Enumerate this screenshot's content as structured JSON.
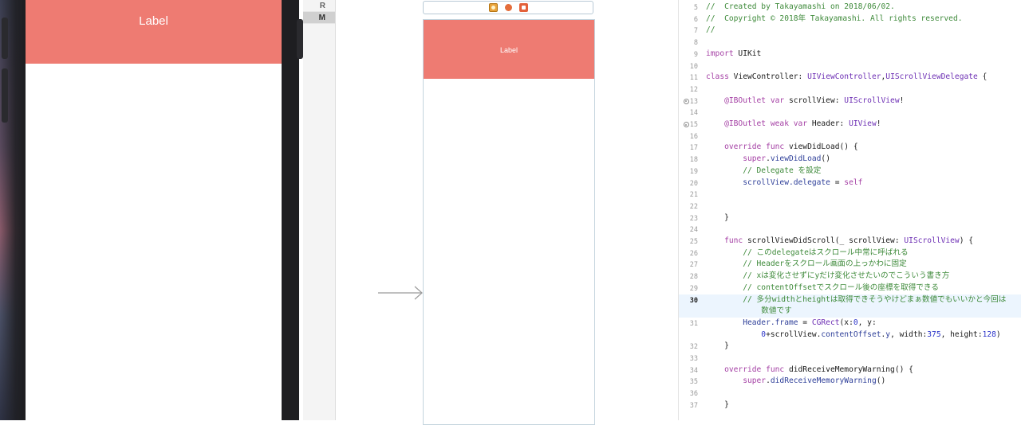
{
  "simulator": {
    "header_label": "Label"
  },
  "outline_strip": {
    "rows": [
      "R",
      "M"
    ]
  },
  "storyboard": {
    "header_label": "Label"
  },
  "editor": {
    "lines": [
      {
        "n": "5",
        "segs": [
          {
            "t": "//  Created by Takayamashi on 2018/06/02.",
            "c": "com"
          }
        ]
      },
      {
        "n": "6",
        "segs": [
          {
            "t": "//  Copyright © 2018年 Takayamashi. All rights reserved.",
            "c": "com"
          }
        ]
      },
      {
        "n": "7",
        "segs": [
          {
            "t": "//",
            "c": "com"
          }
        ]
      },
      {
        "n": "8",
        "segs": []
      },
      {
        "n": "9",
        "segs": [
          {
            "t": "import",
            "c": "kw"
          },
          {
            "t": " UIKit",
            "c": ""
          }
        ]
      },
      {
        "n": "10",
        "segs": []
      },
      {
        "n": "11",
        "segs": [
          {
            "t": "class",
            "c": "kw"
          },
          {
            "t": " ViewController: ",
            "c": ""
          },
          {
            "t": "UIViewController",
            "c": "type"
          },
          {
            "t": ",",
            "c": ""
          },
          {
            "t": "UIScrollViewDelegate",
            "c": "type"
          },
          {
            "t": " {",
            "c": ""
          }
        ]
      },
      {
        "n": "12",
        "segs": []
      },
      {
        "n": "13",
        "bp": true,
        "segs": [
          {
            "t": "    @IBOutlet",
            "c": "kw"
          },
          {
            "t": " ",
            "c": ""
          },
          {
            "t": "var",
            "c": "kw"
          },
          {
            "t": " scrollView: ",
            "c": ""
          },
          {
            "t": "UIScrollView",
            "c": "type"
          },
          {
            "t": "!",
            "c": ""
          }
        ]
      },
      {
        "n": "14",
        "segs": []
      },
      {
        "n": "15",
        "bp": true,
        "segs": [
          {
            "t": "    @IBOutlet",
            "c": "kw"
          },
          {
            "t": " ",
            "c": ""
          },
          {
            "t": "weak var",
            "c": "kw"
          },
          {
            "t": " Header: ",
            "c": ""
          },
          {
            "t": "UIView",
            "c": "type"
          },
          {
            "t": "!",
            "c": ""
          }
        ]
      },
      {
        "n": "16",
        "segs": []
      },
      {
        "n": "17",
        "segs": [
          {
            "t": "    override func",
            "c": "kw"
          },
          {
            "t": " viewDidLoad() {",
            "c": ""
          }
        ]
      },
      {
        "n": "18",
        "segs": [
          {
            "t": "        super",
            "c": "kw"
          },
          {
            "t": ".",
            "c": ""
          },
          {
            "t": "viewDidLoad",
            "c": "fn"
          },
          {
            "t": "()",
            "c": ""
          }
        ]
      },
      {
        "n": "19",
        "segs": [
          {
            "t": "        // Delegate を設定",
            "c": "com"
          }
        ]
      },
      {
        "n": "20",
        "segs": [
          {
            "t": "        scrollView.",
            "c": "fn"
          },
          {
            "t": "delegate",
            "c": "fn"
          },
          {
            "t": " = ",
            "c": ""
          },
          {
            "t": "self",
            "c": "kw"
          }
        ]
      },
      {
        "n": "21",
        "segs": []
      },
      {
        "n": "22",
        "segs": []
      },
      {
        "n": "23",
        "segs": [
          {
            "t": "    }",
            "c": ""
          }
        ]
      },
      {
        "n": "24",
        "segs": []
      },
      {
        "n": "25",
        "segs": [
          {
            "t": "    func",
            "c": "kw"
          },
          {
            "t": " scrollViewDidScroll(_ scrollView: ",
            "c": ""
          },
          {
            "t": "UIScrollView",
            "c": "type"
          },
          {
            "t": ") {",
            "c": ""
          }
        ]
      },
      {
        "n": "26",
        "segs": [
          {
            "t": "        // このdelegateはスクロール中常に呼ばれる",
            "c": "com"
          }
        ]
      },
      {
        "n": "27",
        "segs": [
          {
            "t": "        // Headerをスクロール画面の上っかわに固定",
            "c": "com"
          }
        ]
      },
      {
        "n": "28",
        "segs": [
          {
            "t": "        // xは変化させずにyだけ変化させたいのでこういう書き方",
            "c": "com"
          }
        ]
      },
      {
        "n": "29",
        "segs": [
          {
            "t": "        // contentOffsetでスクロール後の座標を取得できる",
            "c": "com"
          }
        ]
      },
      {
        "n": "30",
        "current": true,
        "segs": [
          {
            "t": "        // 多分widthとheightは取得できそうやけどまぁ数値でもいいかと今回は",
            "c": "com"
          }
        ]
      },
      {
        "n": "",
        "current": true,
        "segs": [
          {
            "t": "            数値です",
            "c": "com"
          }
        ]
      },
      {
        "n": "31",
        "segs": [
          {
            "t": "        Header.",
            "c": "fn"
          },
          {
            "t": "frame",
            "c": "fn"
          },
          {
            "t": " = ",
            "c": ""
          },
          {
            "t": "CGRect",
            "c": "type"
          },
          {
            "t": "(x:",
            "c": ""
          },
          {
            "t": "0",
            "c": "num"
          },
          {
            "t": ", y:",
            "c": ""
          }
        ]
      },
      {
        "n": "",
        "segs": [
          {
            "t": "            0",
            "c": "num"
          },
          {
            "t": "+scrollView.",
            "c": ""
          },
          {
            "t": "contentOffset",
            "c": "fn"
          },
          {
            "t": ".",
            "c": ""
          },
          {
            "t": "y",
            "c": "fn"
          },
          {
            "t": ", width:",
            "c": ""
          },
          {
            "t": "375",
            "c": "num"
          },
          {
            "t": ", height:",
            "c": ""
          },
          {
            "t": "128",
            "c": "num"
          },
          {
            "t": ")",
            "c": ""
          }
        ]
      },
      {
        "n": "32",
        "segs": [
          {
            "t": "    }",
            "c": ""
          }
        ]
      },
      {
        "n": "33",
        "segs": []
      },
      {
        "n": "34",
        "segs": [
          {
            "t": "    override func",
            "c": "kw"
          },
          {
            "t": " didReceiveMemoryWarning() {",
            "c": ""
          }
        ]
      },
      {
        "n": "35",
        "segs": [
          {
            "t": "        super",
            "c": "kw"
          },
          {
            "t": ".",
            "c": ""
          },
          {
            "t": "didReceiveMemoryWarning",
            "c": "fn"
          },
          {
            "t": "()",
            "c": ""
          }
        ]
      },
      {
        "n": "36",
        "segs": []
      },
      {
        "n": "37",
        "segs": [
          {
            "t": "    }",
            "c": ""
          }
        ]
      }
    ]
  }
}
